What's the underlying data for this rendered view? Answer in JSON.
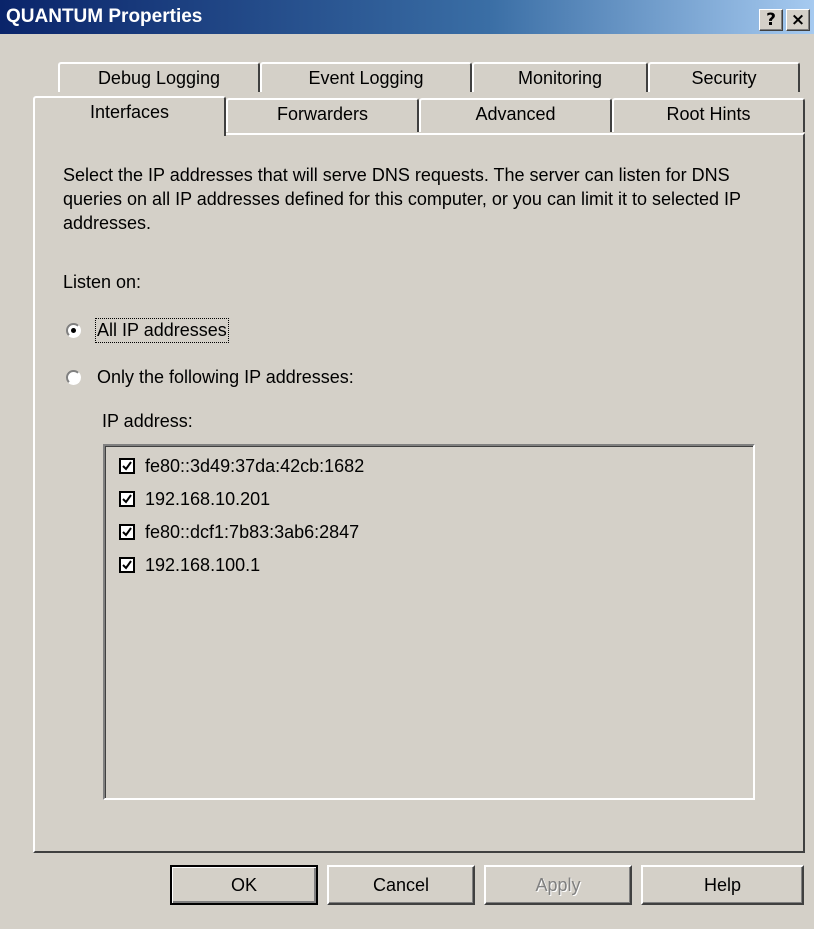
{
  "window": {
    "title": "QUANTUM Properties",
    "help_button": "?",
    "close_button": "×"
  },
  "tabs": {
    "row1": [
      "Debug Logging",
      "Event Logging",
      "Monitoring",
      "Security"
    ],
    "row2": [
      "Interfaces",
      "Forwarders",
      "Advanced",
      "Root Hints"
    ],
    "active": "Interfaces"
  },
  "interfaces": {
    "description": "Select the IP addresses that will serve DNS requests. The server can listen for DNS queries on all IP addresses defined for this computer, or you can limit it to selected IP addresses.",
    "listen_on_label": "Listen on:",
    "radio_all": {
      "label": "All IP addresses",
      "selected": true
    },
    "radio_only": {
      "label": "Only the following IP addresses:",
      "selected": false
    },
    "ip_list_label": "IP address:",
    "ip_addresses": [
      {
        "address": "fe80::3d49:37da:42cb:1682",
        "checked": true
      },
      {
        "address": "192.168.10.201",
        "checked": true
      },
      {
        "address": "fe80::dcf1:7b83:3ab6:2847",
        "checked": true
      },
      {
        "address": "192.168.100.1",
        "checked": true
      }
    ]
  },
  "buttons": {
    "ok": "OK",
    "cancel": "Cancel",
    "apply": "Apply",
    "help": "Help"
  }
}
